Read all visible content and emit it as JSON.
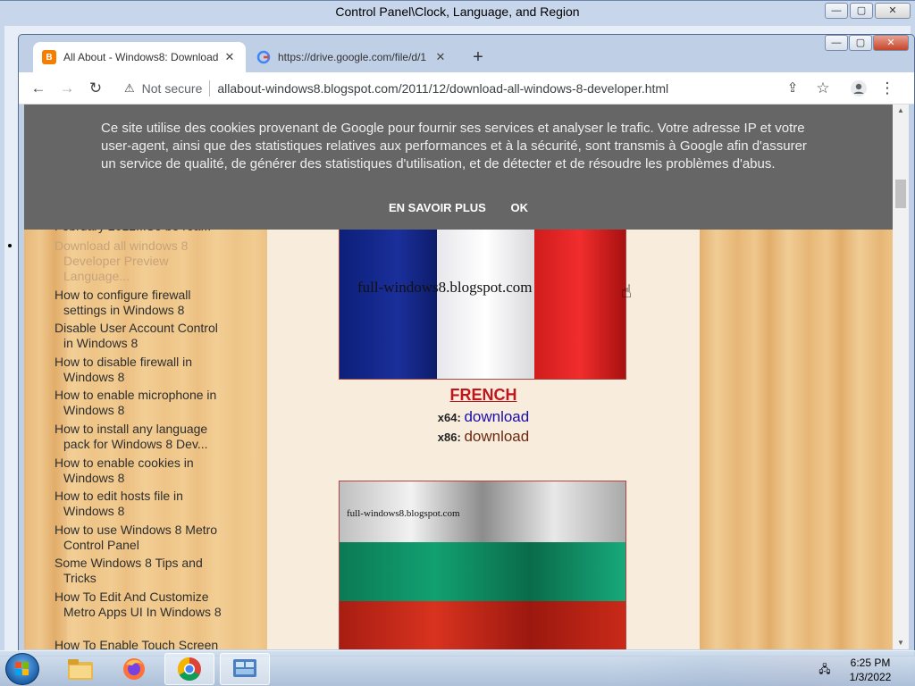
{
  "desktop": {
    "control_panel_title": "Control Panel\\Clock, Language, and Region"
  },
  "window_buttons": {
    "minimize": "—",
    "maximize": "▢",
    "close": "✕"
  },
  "browser": {
    "tabs": [
      {
        "label": "All About - Windows8: Download",
        "favicon": "blogger-icon",
        "favicon_color": "#f57d00"
      },
      {
        "label": "https://drive.google.com/file/d/1",
        "favicon": "google-icon"
      }
    ],
    "new_tab": "+",
    "address": {
      "security_label": "Not secure",
      "url": "allabout-windows8.blogspot.com/2011/12/download-all-windows-8-developer.html"
    }
  },
  "cookie_banner": {
    "message": "Ce site utilise des cookies provenant de Google pour fournir ses services et analyser le trafic. Votre adresse IP et votre user-agent, ainsi que des statistiques relatives aux performances et à la sécurité, sont transmis à Google afin d'assurer un service de qualité, de générer des statistiques d'utilisation, et de détecter et de résoudre les problèmes d'abus.",
    "learn_more": "EN SAVOIR PLUS",
    "ok": "OK"
  },
  "sidebar": {
    "items": [
      {
        "label": "February 2012...So be rea...",
        "dim": false
      },
      {
        "label": "Download all windows 8 Developer Preview Language...",
        "dim": true
      },
      {
        "label": "How to configure firewall settings in Windows 8",
        "dim": false
      },
      {
        "label": "Disable User Account Control in Windows 8",
        "dim": false
      },
      {
        "label": "How to disable firewall in Windows 8",
        "dim": false
      },
      {
        "label": "How to enable microphone in Windows 8",
        "dim": false
      },
      {
        "label": "How to install any language pack for Windows 8 Dev...",
        "dim": false
      },
      {
        "label": "How to enable cookies in Windows 8",
        "dim": false
      },
      {
        "label": "How to edit hosts file in Windows 8",
        "dim": false
      },
      {
        "label": "How to use Windows 8 Metro Control Panel",
        "dim": false
      },
      {
        "label": "Some Windows 8 Tips and Tricks",
        "dim": false
      },
      {
        "label": "How To Edit And Customize Metro Apps UI In Windows 8",
        "dim": false
      },
      {
        "label": "How To Enable Touch Screen",
        "dim": false
      }
    ]
  },
  "content": {
    "flag1_watermark": "full-windows8.blogspot.com",
    "language": "FRENCH",
    "x64_label": "x64",
    "x64_link": "download",
    "x64_link_color": "#1a0dab",
    "x86_label": "x86",
    "x86_link": "download",
    "x86_link_color": "#6b2a10",
    "flag2_watermark": "full-windows8.blogspot.com"
  },
  "taskbar": {
    "apps": [
      "explorer-icon",
      "firefox-icon",
      "chrome-icon",
      "control-panel-icon"
    ],
    "time": "6:25 PM",
    "date": "1/3/2022"
  }
}
